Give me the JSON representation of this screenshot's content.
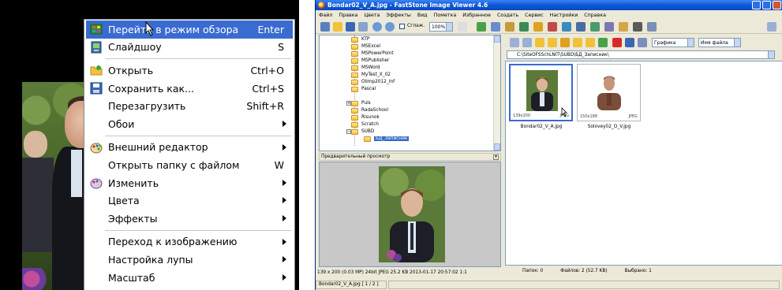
{
  "context_menu": {
    "items": [
      {
        "label": "Перейти в режим обзора",
        "shortcut": "Enter",
        "icon": "browse-mode-icon",
        "highlighted": true
      },
      {
        "label": "Слайдшоу",
        "shortcut": "S",
        "icon": "slideshow-icon"
      },
      {
        "label": "Открыть",
        "shortcut": "Ctrl+O",
        "icon": "open-folder-icon"
      },
      {
        "label": "Сохранить как...",
        "shortcut": "Ctrl+S",
        "icon": "save-disk-icon"
      },
      {
        "label": "Перезагрузить",
        "shortcut": "Shift+R"
      },
      {
        "label": "Обои",
        "submenu": true
      },
      {
        "label": "Внешний редактор",
        "submenu": true,
        "icon": "palette-icon"
      },
      {
        "label": "Открыть папку с файлом",
        "shortcut": "W"
      },
      {
        "label": "Изменить",
        "submenu": true,
        "icon": "palette-icon"
      },
      {
        "label": "Цвета",
        "submenu": true
      },
      {
        "label": "Эффекты",
        "submenu": true
      },
      {
        "label": "Переход к изображению",
        "submenu": true
      },
      {
        "label": "Настройка лупы",
        "submenu": true
      },
      {
        "label": "Масштаб",
        "submenu": true
      }
    ],
    "highlight_color": "#3a6bd0"
  },
  "window": {
    "title": "Bondar02_V_A.jpg  -  FastStone Image Viewer 4.6",
    "titlebar_color": "#0d57d8",
    "menu": [
      "Файл",
      "Правка",
      "Цвета",
      "Эффекты",
      "Вид",
      "Пометка",
      "Избранное",
      "Создать",
      "Сервис",
      "Настройки",
      "Справка"
    ],
    "toolbar": {
      "smooth_label": "Сглаж.",
      "zoom_value": "100%",
      "view_mode": "Графика",
      "sort_by": "Имя файла"
    },
    "tree": {
      "folders": [
        "KTP",
        "MSExcel",
        "MSPowerPoint",
        "MSPublisher",
        "MSWord",
        "MyTest_X_02",
        "Olimp2012_Inf",
        "Pascal",
        "Puls",
        "RadaSchool",
        "Risunok",
        "Scratch",
        "SUBD"
      ],
      "selected_subfolder": "БД_Записник"
    },
    "preview_title": "Предварительный просмотр",
    "path": "C:\\SiteOFSSchLNIT\\SUBD\\БД_Записник\\",
    "thumbnails": [
      {
        "name": "Bondar02_V_A.jpg",
        "dims": "139x200",
        "format": "JPEG",
        "selected": true
      },
      {
        "name": "Solovey02_O_V.jpg",
        "dims": "150x188",
        "format": "JPEG",
        "selected": false
      }
    ],
    "info_bar": "139 x 200 (0.03 MP)  24bit  JPEG  25.2 KB  2013-01-17 20:57:02  1:1",
    "file_position": "Bondar02_V_A.jpg [ 1 / 2 ]",
    "status": {
      "folders": "Папок: 0",
      "files": "Файлов: 2 (52.7 KB)",
      "selected": "Выбрано: 1"
    }
  }
}
